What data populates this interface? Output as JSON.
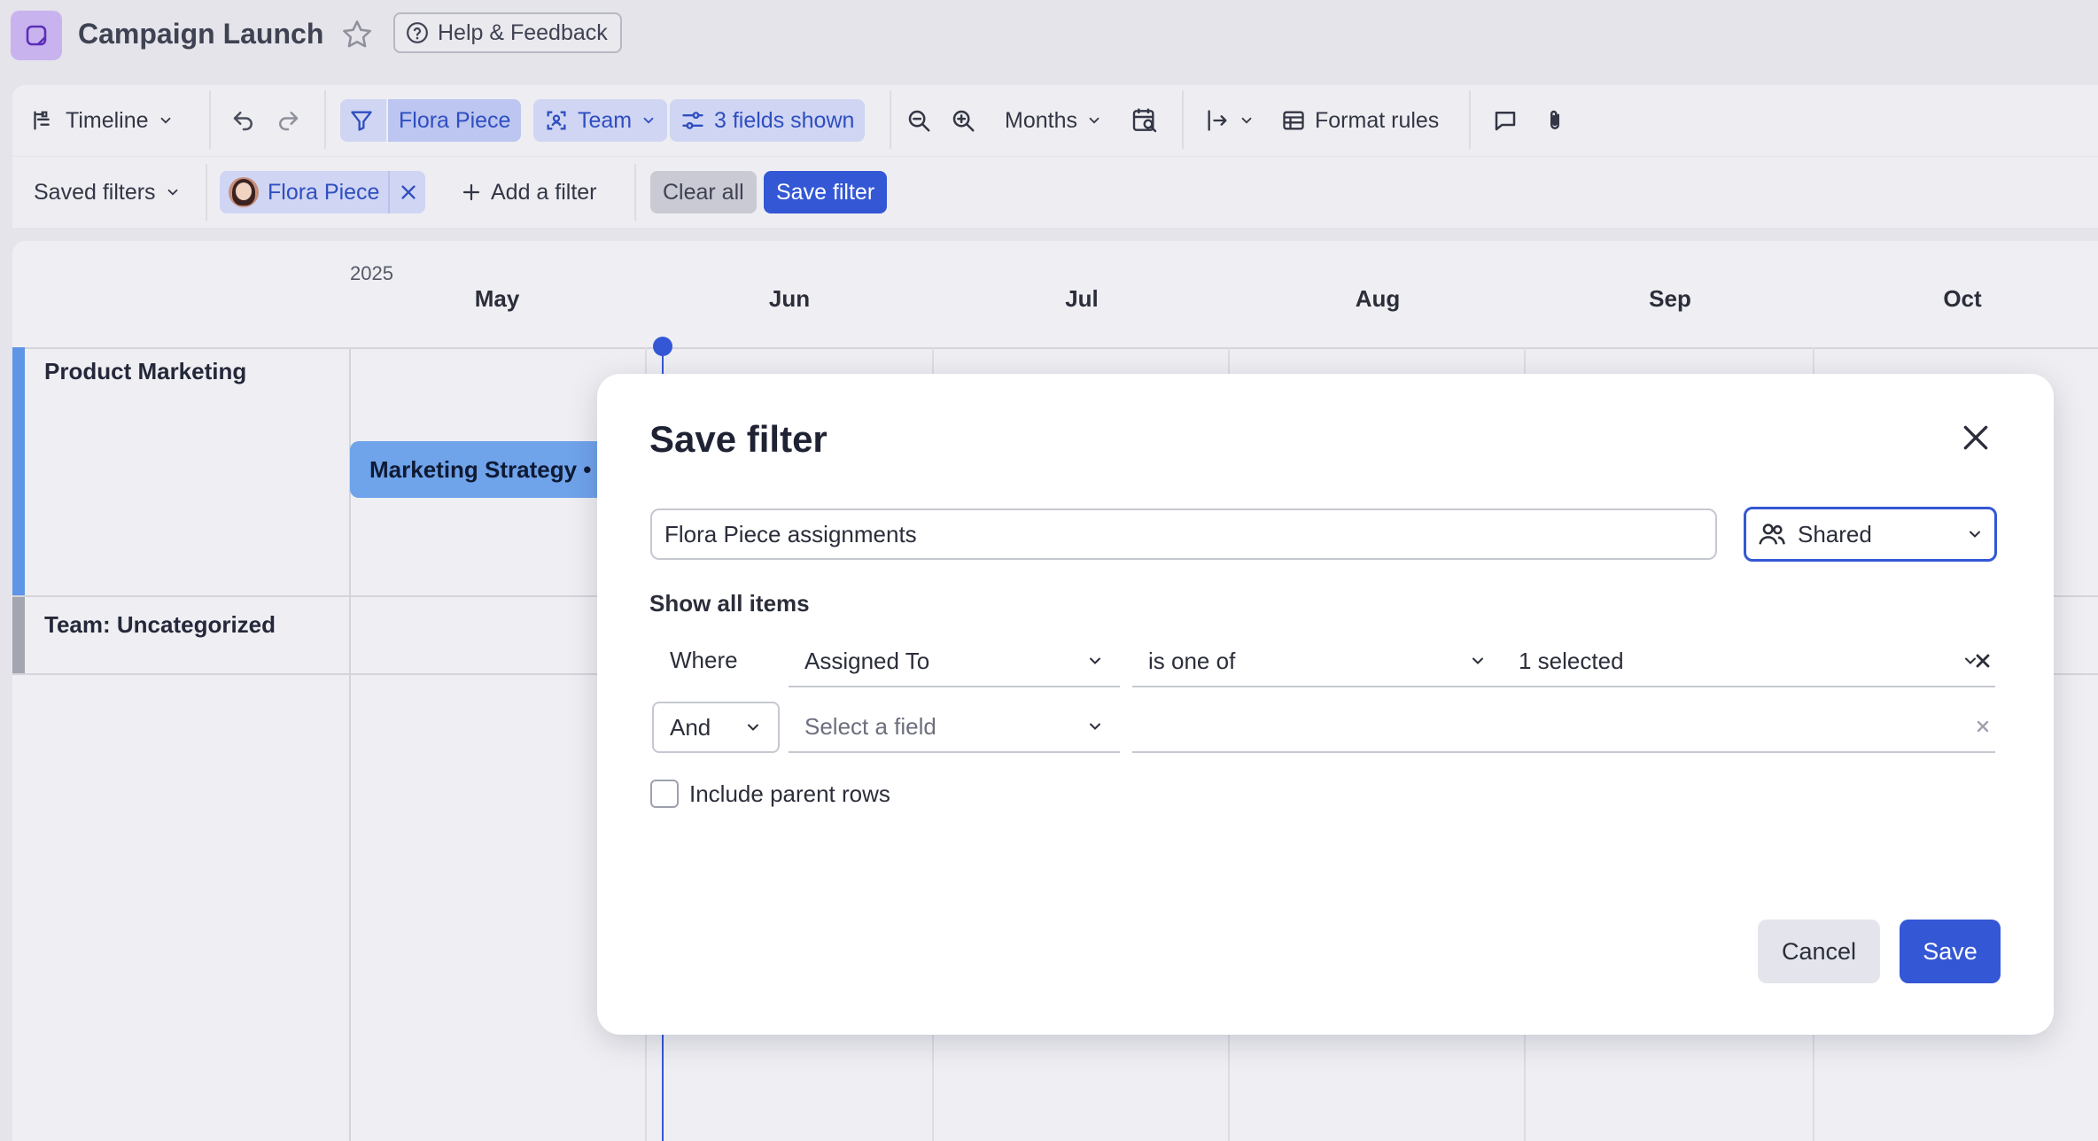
{
  "header": {
    "title": "Campaign Launch",
    "help_label": "Help & Feedback"
  },
  "toolbar": {
    "view_label": "Timeline",
    "filter_person": "Flora Piece",
    "group_label": "Team",
    "fields_label": "3 fields shown",
    "scale_label": "Months",
    "format_rules_label": "Format rules"
  },
  "filterbar": {
    "saved_filters_label": "Saved filters",
    "active_chip": "Flora Piece",
    "add_filter_label": "Add a filter",
    "clear_all_label": "Clear all",
    "save_filter_label": "Save filter"
  },
  "timeline": {
    "year": "2025",
    "months": [
      "May",
      "Jun",
      "Jul",
      "Aug",
      "Sep",
      "Oct"
    ],
    "groups": [
      {
        "label": "Product Marketing",
        "color": "#5f95e6"
      },
      {
        "label": "Team: Uncategorized",
        "color": "#a3a5b0"
      }
    ],
    "task": "Marketing Strategy •"
  },
  "modal": {
    "title": "Save filter",
    "name_value": "Flora Piece assignments",
    "sharing_value": "Shared",
    "show_all_label": "Show all items",
    "condition": {
      "where_label": "Where",
      "field": "Assigned To",
      "operator": "is one of",
      "value": "1 selected"
    },
    "next_condition": {
      "conjunction": "And",
      "field_placeholder": "Select a field"
    },
    "include_parent_label": "Include parent rows",
    "cancel_label": "Cancel",
    "save_label": "Save"
  },
  "colors": {
    "accent": "#3457d5",
    "pill_bg": "#cfd5f3",
    "app_icon_bg": "#c9b3ef"
  }
}
